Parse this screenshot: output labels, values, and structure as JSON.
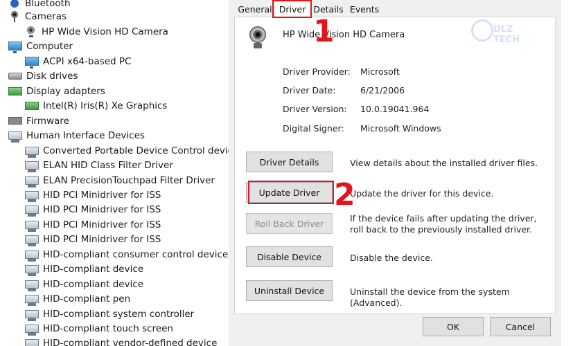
{
  "device_tree": {
    "items": [
      {
        "label": "Bluetooth",
        "icon": "bluetooth-icon",
        "level": 0
      },
      {
        "label": "Cameras",
        "icon": "camera-icon",
        "level": 0
      },
      {
        "label": "HP Wide Vision HD Camera",
        "icon": "webcam-icon",
        "level": 1
      },
      {
        "label": "Computer",
        "icon": "computer-icon",
        "level": 0
      },
      {
        "label": "ACPI x64-based PC",
        "icon": "monitor-icon",
        "level": 1
      },
      {
        "label": "Disk drives",
        "icon": "disk-drive-icon",
        "level": 0
      },
      {
        "label": "Display adapters",
        "icon": "display-adapter-icon",
        "level": 0
      },
      {
        "label": "Intel(R) Iris(R) Xe Graphics",
        "icon": "graphics-card-icon",
        "level": 1
      },
      {
        "label": "Firmware",
        "icon": "firmware-icon",
        "level": 0
      },
      {
        "label": "Human Interface Devices",
        "icon": "hid-icon",
        "level": 0
      },
      {
        "label": "Converted Portable Device Control device",
        "icon": "hid-icon",
        "level": 1
      },
      {
        "label": "ELAN HID Class Filter Driver",
        "icon": "hid-icon",
        "level": 1
      },
      {
        "label": "ELAN PrecisionTouchpad Filter Driver",
        "icon": "hid-icon",
        "level": 1
      },
      {
        "label": "HID PCI Minidriver for ISS",
        "icon": "hid-icon",
        "level": 1
      },
      {
        "label": "HID PCI Minidriver for ISS",
        "icon": "hid-icon",
        "level": 1
      },
      {
        "label": "HID PCI Minidriver for ISS",
        "icon": "hid-icon",
        "level": 1
      },
      {
        "label": "HID PCI Minidriver for ISS",
        "icon": "hid-icon",
        "level": 1
      },
      {
        "label": "HID-compliant consumer control device",
        "icon": "hid-icon",
        "level": 1
      },
      {
        "label": "HID-compliant device",
        "icon": "hid-icon",
        "level": 1
      },
      {
        "label": "HID-compliant device",
        "icon": "hid-icon",
        "level": 1
      },
      {
        "label": "HID-compliant pen",
        "icon": "hid-icon",
        "level": 1
      },
      {
        "label": "HID-compliant system controller",
        "icon": "hid-icon",
        "level": 1
      },
      {
        "label": "HID-compliant touch screen",
        "icon": "hid-icon",
        "level": 1
      },
      {
        "label": "HID-compliant vendor-defined device",
        "icon": "hid-icon",
        "level": 1
      }
    ]
  },
  "dialog": {
    "tabs": [
      "General",
      "Driver",
      "Details",
      "Events"
    ],
    "active_tab": "Driver",
    "device_name": "HP Wide Vision HD Camera",
    "info": [
      {
        "key": "Driver Provider:",
        "value": "Microsoft"
      },
      {
        "key": "Driver Date:",
        "value": "6/21/2006"
      },
      {
        "key": "Driver Version:",
        "value": "10.0.19041.964"
      },
      {
        "key": "Digital Signer:",
        "value": "Microsoft Windows"
      }
    ],
    "actions": [
      {
        "label": "Driver Details",
        "description": "View details about the installed driver files.",
        "enabled": true
      },
      {
        "label": "Update Driver",
        "description": "Update the driver for this device.",
        "enabled": true
      },
      {
        "label": "Roll Back Driver",
        "description": "If the device fails after updating the driver, roll back to the previously installed driver.",
        "enabled": false
      },
      {
        "label": "Disable Device",
        "description": "Disable the device.",
        "enabled": true
      },
      {
        "label": "Uninstall Device",
        "description": "Uninstall the device from the system (Advanced).",
        "enabled": true
      }
    ],
    "ok_label": "OK",
    "cancel_label": "Cancel"
  },
  "annotations": {
    "step1": "1",
    "step2": "2"
  },
  "watermark": "DLZ TECH",
  "colors": {
    "highlight": "#e0161c",
    "dialog_bg": "#f0f0f0",
    "button_bg": "#e1e1e1"
  }
}
